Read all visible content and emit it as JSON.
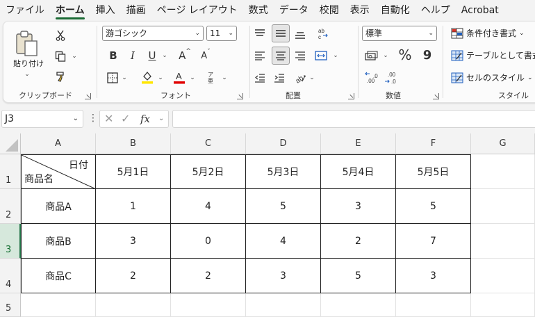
{
  "menu": {
    "tabs": [
      "ファイル",
      "ホーム",
      "挿入",
      "描画",
      "ページ レイアウト",
      "数式",
      "データ",
      "校閲",
      "表示",
      "自動化",
      "ヘルプ",
      "Acrobat"
    ],
    "active_tab": "ホーム"
  },
  "ribbon": {
    "clipboard": {
      "paste_label": "貼り付け",
      "group_label": "クリップボード"
    },
    "font": {
      "font_name": "游ゴシック",
      "font_size": "11",
      "bold": "B",
      "italic": "I",
      "underline": "U",
      "grow": "A",
      "shrink": "A",
      "group_label": "フォント",
      "furigana": "ア亜"
    },
    "alignment": {
      "group_label": "配置"
    },
    "number": {
      "format": "標準",
      "percent": "%",
      "comma": "9",
      "group_label": "数値"
    },
    "styles": {
      "conditional": "条件付き書式",
      "table": "テーブルとして書式",
      "cell_style": "セルのスタイル",
      "group_label": "スタイル"
    }
  },
  "formula_bar": {
    "name_box": "J3",
    "fx": "fx",
    "formula": ""
  },
  "sheet": {
    "columns": [
      "A",
      "B",
      "C",
      "D",
      "E",
      "F",
      "G"
    ],
    "rows": [
      "1",
      "2",
      "3",
      "4",
      "5"
    ],
    "active_row": "3",
    "header_top_right": "日付",
    "header_bottom_left": "商品名",
    "dates": [
      "5月1日",
      "5月2日",
      "5月3日",
      "5月4日",
      "5月5日"
    ],
    "products": [
      {
        "name": "商品A",
        "values": [
          "1",
          "4",
          "5",
          "3",
          "5"
        ]
      },
      {
        "name": "商品B",
        "values": [
          "3",
          "0",
          "4",
          "2",
          "7"
        ]
      },
      {
        "name": "商品C",
        "values": [
          "2",
          "2",
          "3",
          "5",
          "3"
        ]
      }
    ]
  },
  "colors": {
    "accent": "#217346",
    "font_color": "#e00000",
    "highlight": "#ffe600"
  }
}
